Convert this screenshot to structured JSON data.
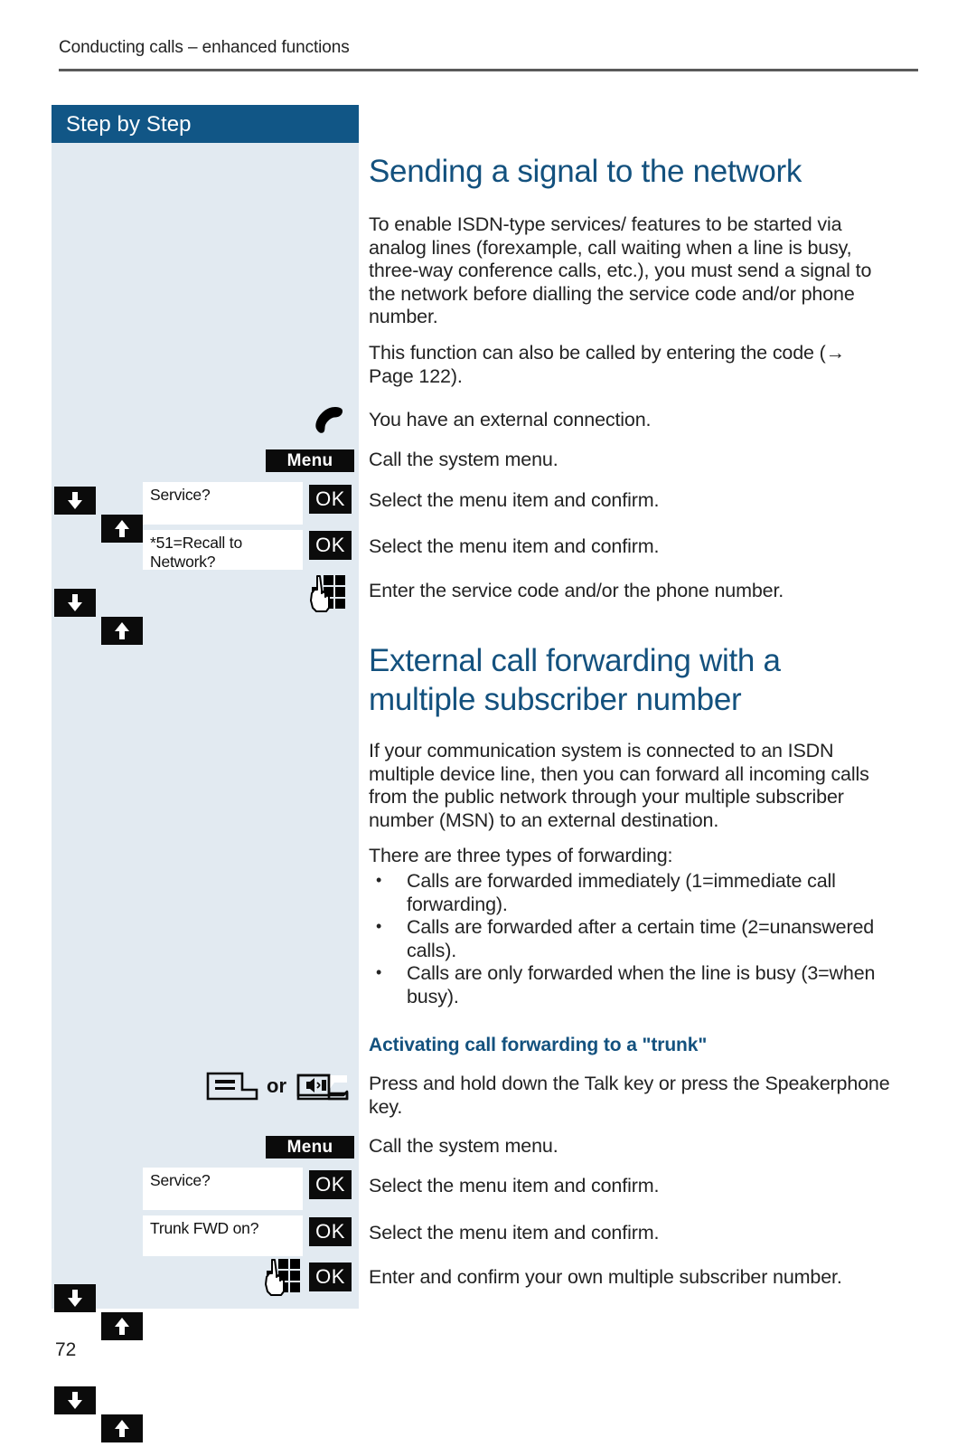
{
  "page": {
    "running_header": "Conducting calls – enhanced functions",
    "page_number": "72",
    "accent_color": "#13517e",
    "sidebar_bg": "#e2eaf1",
    "sidebar_title_bg": "#115686"
  },
  "sidebar": {
    "title": "Step by Step"
  },
  "section1": {
    "heading": "Sending a signal to the network",
    "paragraphs": [
      "To enable ISDN-type services/ features to be started via analog lines (forexample, call waiting when a line is busy, three-way conference calls, etc.), you must send a signal to the network before dialling the service code and/or phone number.",
      "This function can also be called by entering the code (→ Page 122)."
    ],
    "steps": [
      {
        "icon": "handset-icon",
        "instruction": "You have an external connection."
      },
      {
        "icon": "menu-key",
        "key_label": "Menu",
        "instruction": "Call the system menu."
      },
      {
        "icon": "arrow-down-up-keys",
        "display_text": "Service?",
        "confirm_label": "OK",
        "instruction": "Select the menu item and confirm."
      },
      {
        "icon": "arrow-down-up-keys",
        "display_text": "*51=Recall to Network?",
        "confirm_label": "OK",
        "instruction": "Select the menu item and confirm."
      },
      {
        "icon": "keypad-icon",
        "instruction": "Enter the service code and/or the phone number."
      }
    ]
  },
  "section2": {
    "heading": "External call forwarding with a multiple subscriber number",
    "paragraphs": [
      "If your communication system is connected to an ISDN multiple device line, then you can forward all incoming calls from the public network through your multiple subscriber number (MSN) to an external destination.",
      "There are three types of forwarding:"
    ],
    "bullets": [
      "Calls are forwarded immediately (1=immediate call forwarding).",
      "Calls are forwarded after a certain time (2=unanswered calls).",
      "Calls are only forwarded when the line is busy (3=when busy)."
    ],
    "subheading": "Activating call forwarding to a \"trunk\"",
    "steps": [
      {
        "icon": "talk-key-icon",
        "or_label": "or",
        "icon2": "speakerphone-key-icon",
        "instruction": "Press and hold down the Talk key or press the Speakerphone key."
      },
      {
        "icon": "menu-key",
        "key_label": "Menu",
        "instruction": "Call the system menu."
      },
      {
        "icon": "arrow-down-up-keys",
        "display_text": "Service?",
        "confirm_label": "OK",
        "instruction": "Select the menu item and confirm."
      },
      {
        "icon": "arrow-down-up-keys",
        "display_text": "Trunk FWD on?",
        "confirm_label": "OK",
        "instruction": "Select the menu item and confirm."
      },
      {
        "icon": "keypad-icon",
        "confirm_label": "OK",
        "instruction": "Enter and confirm your own multiple subscriber number."
      }
    ]
  }
}
